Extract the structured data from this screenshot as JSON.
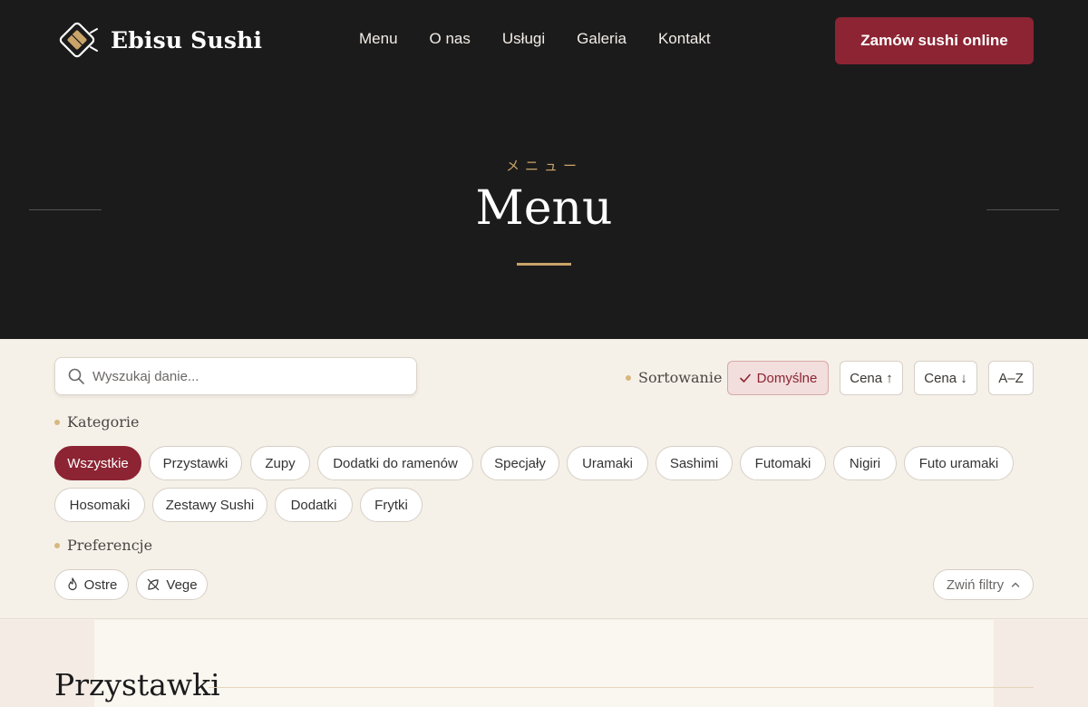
{
  "header": {
    "brand": "Ebisu Sushi",
    "nav": [
      "Menu",
      "O nas",
      "Usługi",
      "Galeria",
      "Kontakt"
    ],
    "order_button": "Zamów sushi online"
  },
  "hero": {
    "kana": "メニュー",
    "title": "Menu"
  },
  "filters": {
    "search_placeholder": "Wyszukaj danie...",
    "sort_label": "Sortowanie",
    "sort_options": [
      {
        "label": "Domyślne",
        "active": true
      },
      {
        "label": "Cena ↑",
        "active": false
      },
      {
        "label": "Cena ↓",
        "active": false
      },
      {
        "label": "A–Z",
        "active": false
      }
    ],
    "categories_label": "Kategorie",
    "categories": [
      {
        "label": "Wszystkie",
        "active": true
      },
      {
        "label": "Przystawki",
        "active": false
      },
      {
        "label": "Zupy",
        "active": false
      },
      {
        "label": "Dodatki do ramenów",
        "active": false
      },
      {
        "label": "Specjały",
        "active": false
      },
      {
        "label": "Uramaki",
        "active": false
      },
      {
        "label": "Sashimi",
        "active": false
      },
      {
        "label": "Futomaki",
        "active": false
      },
      {
        "label": "Nigiri",
        "active": false
      },
      {
        "label": "Futo uramaki",
        "active": false
      },
      {
        "label": "Hosomaki",
        "active": false
      },
      {
        "label": "Zestawy Sushi",
        "active": false
      },
      {
        "label": "Dodatki",
        "active": false
      },
      {
        "label": "Frytki",
        "active": false
      }
    ],
    "preferences_label": "Preferencje",
    "preferences": [
      {
        "label": "Ostre",
        "icon": "flame-icon"
      },
      {
        "label": "Vege",
        "icon": "leaf-off-icon"
      }
    ],
    "collapse_label": "Zwiń filtry"
  },
  "content": {
    "section_title": "Przystawki"
  },
  "colors": {
    "accent": "#8c2433",
    "gold": "#c9a468",
    "dark": "#1c1b1c"
  }
}
